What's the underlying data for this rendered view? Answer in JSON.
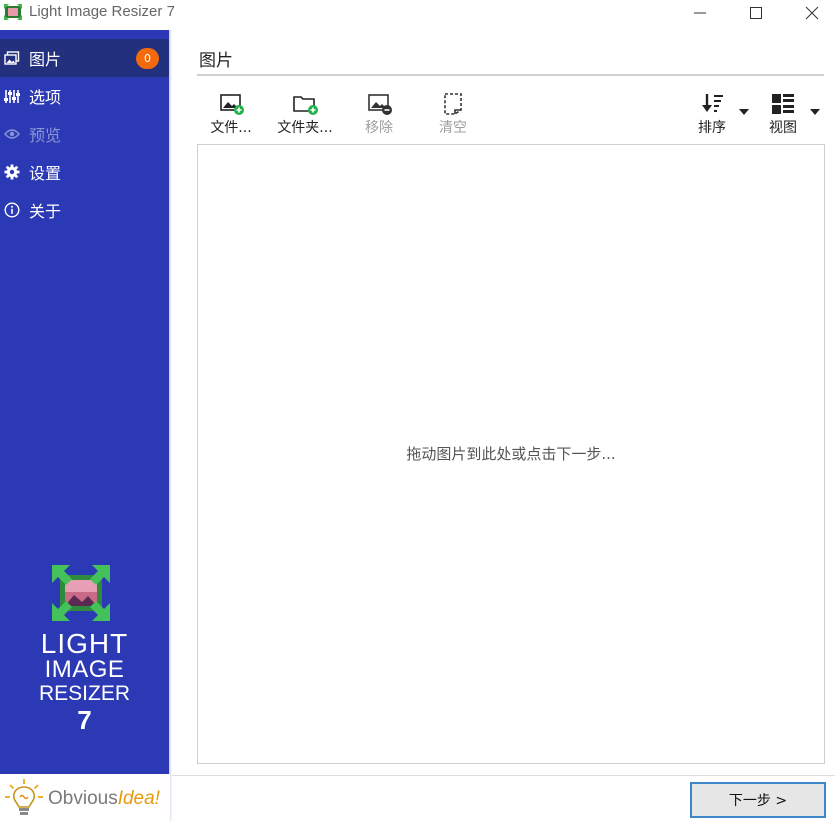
{
  "window": {
    "title": "Light Image Resizer 7"
  },
  "sidebar": {
    "items": [
      {
        "id": "images",
        "label": "图片",
        "icon": "images-icon",
        "badge": "0",
        "active": true
      },
      {
        "id": "options",
        "label": "选项",
        "icon": "sliders-icon"
      },
      {
        "id": "preview",
        "label": "预览",
        "icon": "eye-icon",
        "dimmed": true
      },
      {
        "id": "settings",
        "label": "设置",
        "icon": "gear-icon"
      },
      {
        "id": "about",
        "label": "关于",
        "icon": "info-icon"
      }
    ],
    "logo": {
      "line1": "LIGHT",
      "line2": "IMAGE",
      "line3": "RESIZER",
      "line4": "7"
    },
    "brand": {
      "part1": "Obvious",
      "part2": "Idea!"
    }
  },
  "main": {
    "section_title": "图片",
    "toolbar": {
      "files": {
        "label": "文件...",
        "icon": "add-image-icon"
      },
      "folder": {
        "label": "文件夹...",
        "icon": "add-folder-icon"
      },
      "remove": {
        "label": "移除",
        "icon": "remove-image-icon",
        "disabled": true
      },
      "clear": {
        "label": "清空",
        "icon": "clear-icon",
        "disabled": true
      },
      "sort": {
        "label": "排序",
        "icon": "sort-icon"
      },
      "view": {
        "label": "视图",
        "icon": "view-icon"
      }
    },
    "drop_hint": "拖动图片到此处或点击下一步..."
  },
  "footer": {
    "next_label": "下一步 >"
  },
  "colors": {
    "sidebar_bg": "#2c39b4",
    "sidebar_active": "#22307e",
    "badge": "#f26a0c",
    "accent_button_border": "#3d86c7",
    "plus_green": "#22b14c"
  }
}
